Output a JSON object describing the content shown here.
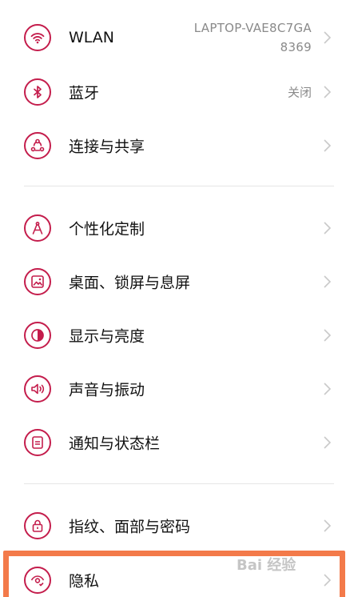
{
  "settings": {
    "section1": [
      {
        "label": "WLAN",
        "value_line1": "LAPTOP-VAE8C7GA",
        "value_line2": "8369",
        "icon": "wifi-icon"
      },
      {
        "label": "蓝牙",
        "value": "关闭",
        "icon": "bluetooth-icon"
      },
      {
        "label": "连接与共享",
        "icon": "connection-share-icon"
      }
    ],
    "section2": [
      {
        "label": "个性化定制",
        "icon": "personalize-icon"
      },
      {
        "label": "桌面、锁屏与息屏",
        "icon": "wallpaper-icon"
      },
      {
        "label": "显示与亮度",
        "icon": "brightness-icon"
      },
      {
        "label": "声音与振动",
        "icon": "sound-icon"
      },
      {
        "label": "通知与状态栏",
        "icon": "notification-icon"
      }
    ],
    "section3": [
      {
        "label": "指纹、面部与密码",
        "icon": "lock-icon"
      },
      {
        "label": "隐私",
        "icon": "privacy-icon"
      }
    ]
  },
  "colors": {
    "accent": "#c41d4c",
    "highlight": "#f37a4a"
  },
  "watermark": "Bai 经验"
}
